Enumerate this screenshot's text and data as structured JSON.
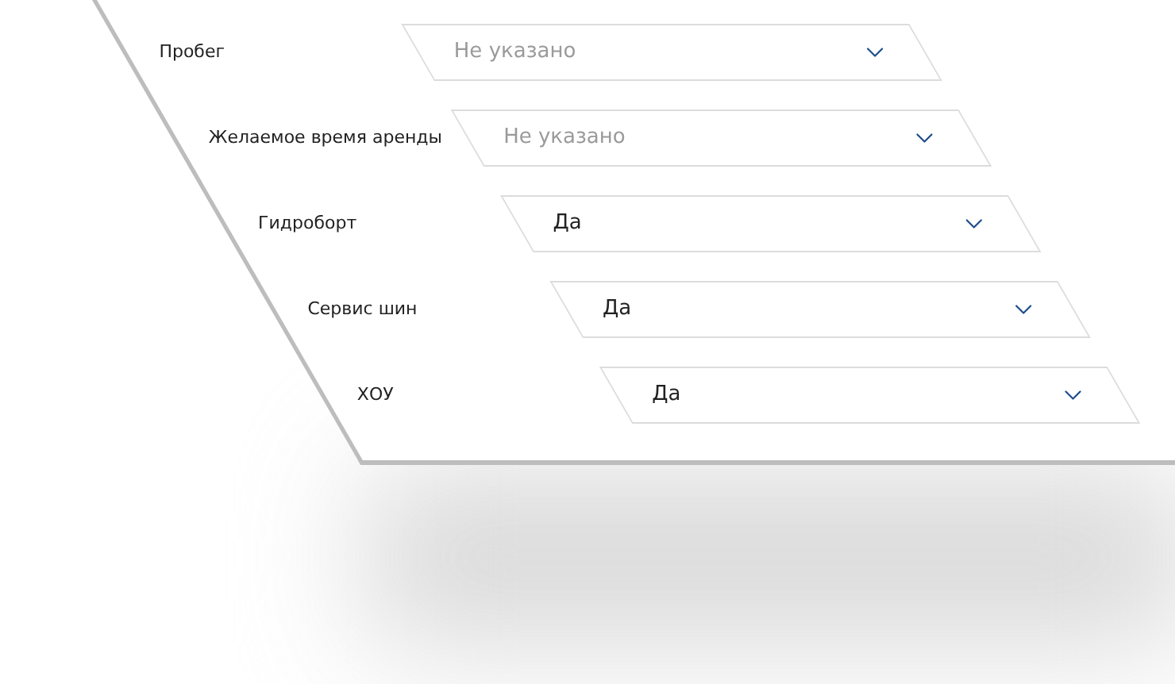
{
  "form": {
    "fields": [
      {
        "label": "Пробег",
        "placeholder": "Не указано"
      },
      {
        "label": "Желаемое время аренды",
        "placeholder": "Не указано"
      },
      {
        "label": "Гидроборт",
        "value": "Да"
      },
      {
        "label": "Сервис шин",
        "value": "Да"
      },
      {
        "label": "ХОУ",
        "value": "Да"
      }
    ]
  }
}
